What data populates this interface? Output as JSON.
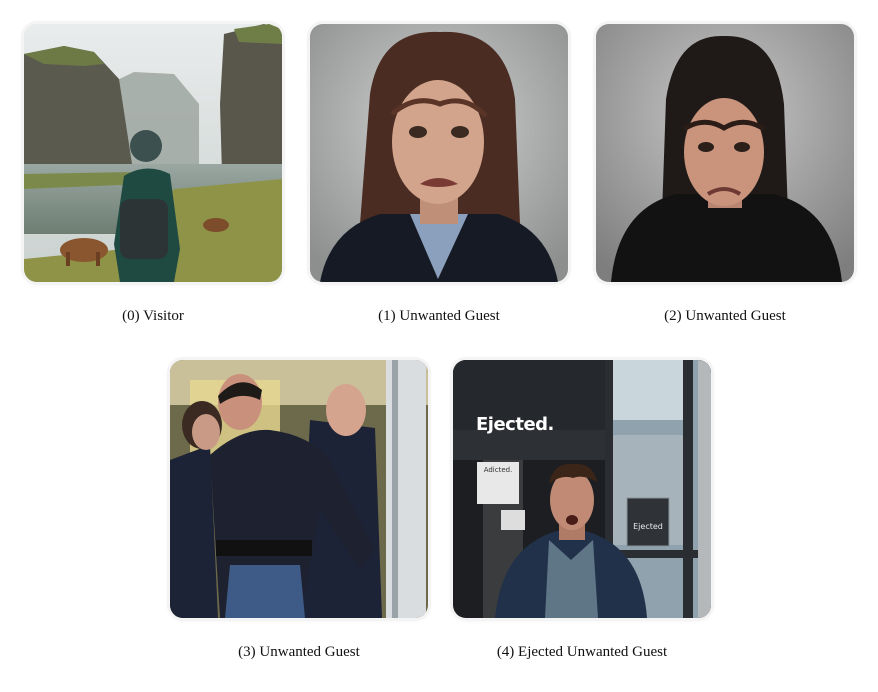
{
  "items": [
    {
      "label": "(0) Visitor",
      "image": "landscape-visitor-photo"
    },
    {
      "label": "(1) Unwanted Guest",
      "image": "frowning-woman-photo"
    },
    {
      "label": "(2) Unwanted Guest",
      "image": "frowning-woman-dark-hair-photo"
    },
    {
      "label": "(3) Unwanted Guest",
      "image": "security-escort-photo"
    },
    {
      "label": "(4) Ejected Unwanted Guest",
      "image": "ejected-man-photo"
    }
  ],
  "sign": {
    "ejected_big": "Ejected.",
    "notice": "Adicted.",
    "door_label": "Ejected"
  }
}
